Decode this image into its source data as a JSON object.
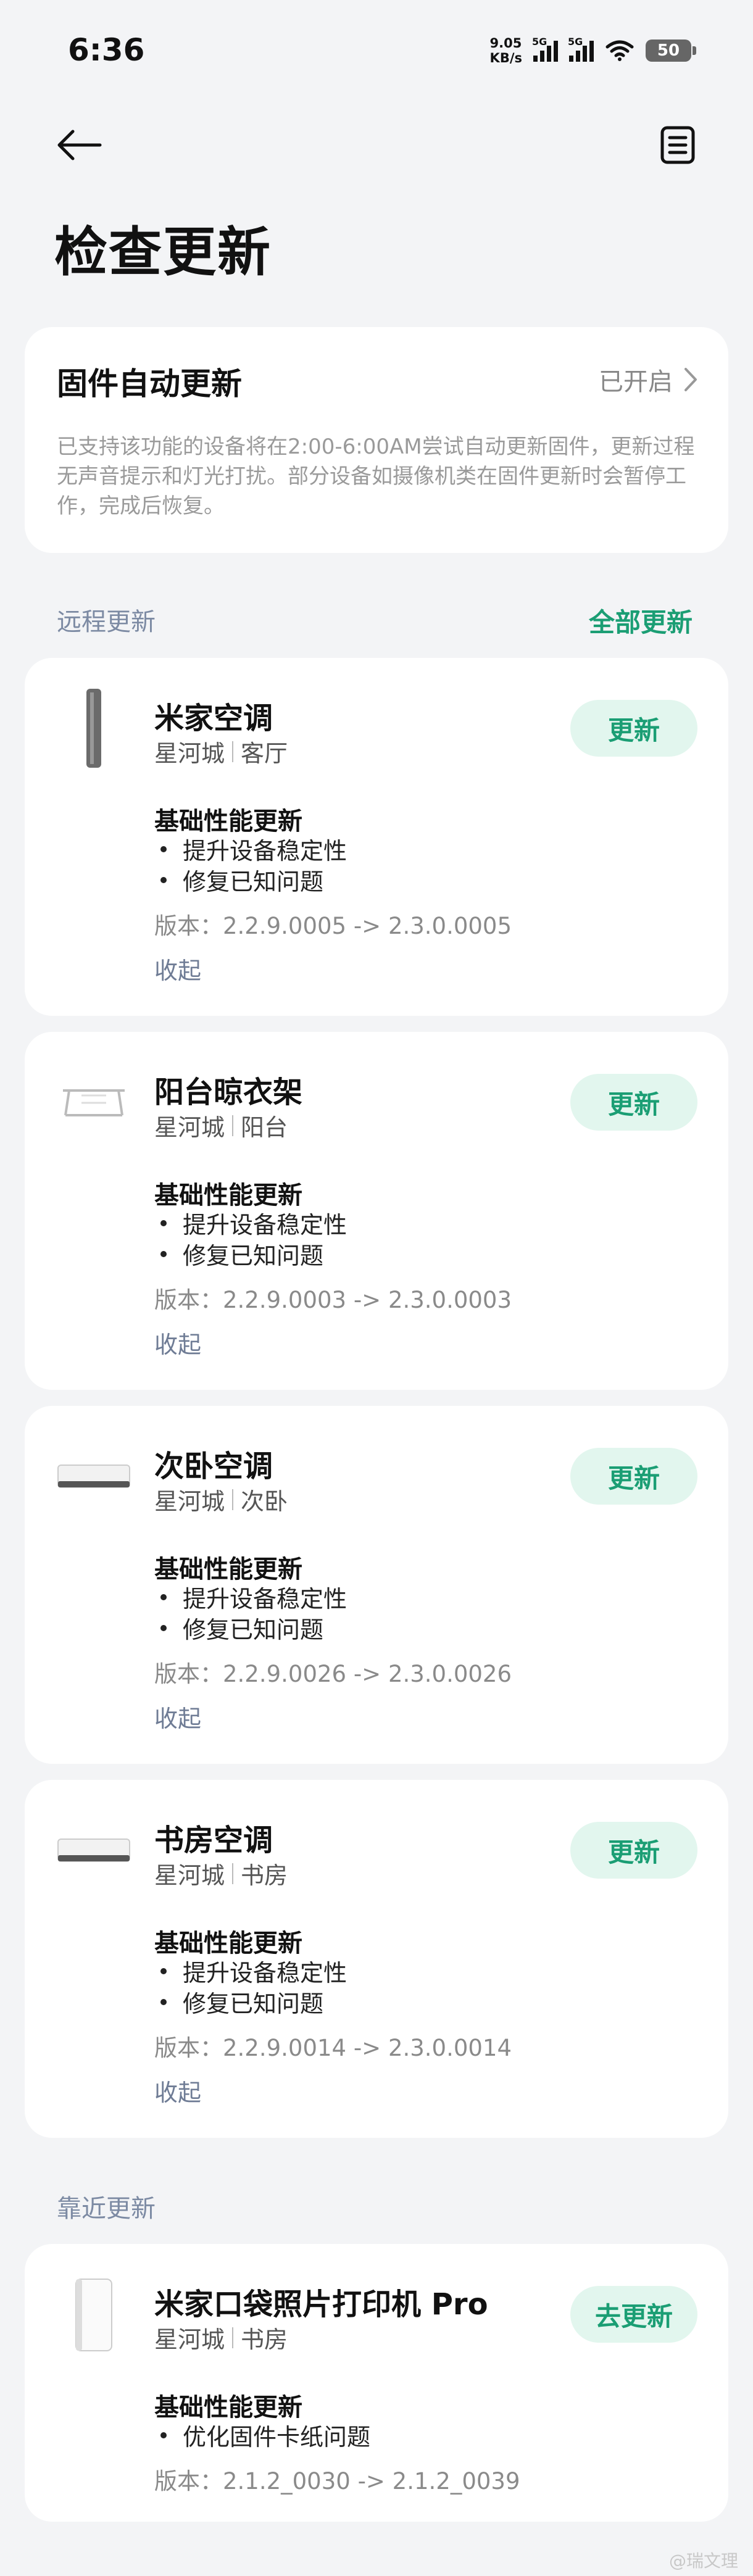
{
  "status_bar": {
    "time": "6:36",
    "speed_value": "9.05",
    "speed_unit": "KB/s",
    "net1": "5G",
    "net2": "5G",
    "battery": "50"
  },
  "icons": {
    "back": "arrow-left-icon",
    "menu": "document-list-icon",
    "chevron": "chevron-right-icon"
  },
  "page_title": "检查更新",
  "auto_update": {
    "title": "固件自动更新",
    "status": "已开启",
    "description": "已支持该功能的设备将在2:00-6:00AM尝试自动更新固件，更新过程无声音提示和灯光打扰。部分设备如摄像机类在固件更新时会暂停工作，完成后恢复。"
  },
  "remote_section": {
    "label": "远程更新",
    "update_all": "全部更新"
  },
  "devices": [
    {
      "name": "米家空调",
      "home": "星河城",
      "room": "客厅",
      "button": "更新",
      "notes_title": "基础性能更新",
      "notes": [
        "提升设备稳定性",
        "修复已知问题"
      ],
      "version": "版本：2.2.9.0005 -> 2.3.0.0005",
      "collapse": "收起",
      "image": "floor-ac-icon"
    },
    {
      "name": "阳台晾衣架",
      "home": "星河城",
      "room": "阳台",
      "button": "更新",
      "notes_title": "基础性能更新",
      "notes": [
        "提升设备稳定性",
        "修复已知问题"
      ],
      "version": "版本：2.2.9.0003 -> 2.3.0.0003",
      "collapse": "收起",
      "image": "clothes-rack-icon"
    },
    {
      "name": "次卧空调",
      "home": "星河城",
      "room": "次卧",
      "button": "更新",
      "notes_title": "基础性能更新",
      "notes": [
        "提升设备稳定性",
        "修复已知问题"
      ],
      "version": "版本：2.2.9.0026 -> 2.3.0.0026",
      "collapse": "收起",
      "image": "wall-ac-icon"
    },
    {
      "name": "书房空调",
      "home": "星河城",
      "room": "书房",
      "button": "更新",
      "notes_title": "基础性能更新",
      "notes": [
        "提升设备稳定性",
        "修复已知问题"
      ],
      "version": "版本：2.2.9.0014 -> 2.3.0.0014",
      "collapse": "收起",
      "image": "wall-ac-icon"
    }
  ],
  "nearby_section": {
    "label": "靠近更新"
  },
  "nearby_device": {
    "name": "米家口袋照片打印机 Pro",
    "home": "星河城",
    "room": "书房",
    "button": "去更新",
    "notes_title": "基础性能更新",
    "notes": [
      "优化固件卡纸问题"
    ],
    "version": "版本：2.1.2_0030 -> 2.1.2_0039",
    "image": "photo-printer-icon"
  },
  "watermark": "@瑞文理"
}
